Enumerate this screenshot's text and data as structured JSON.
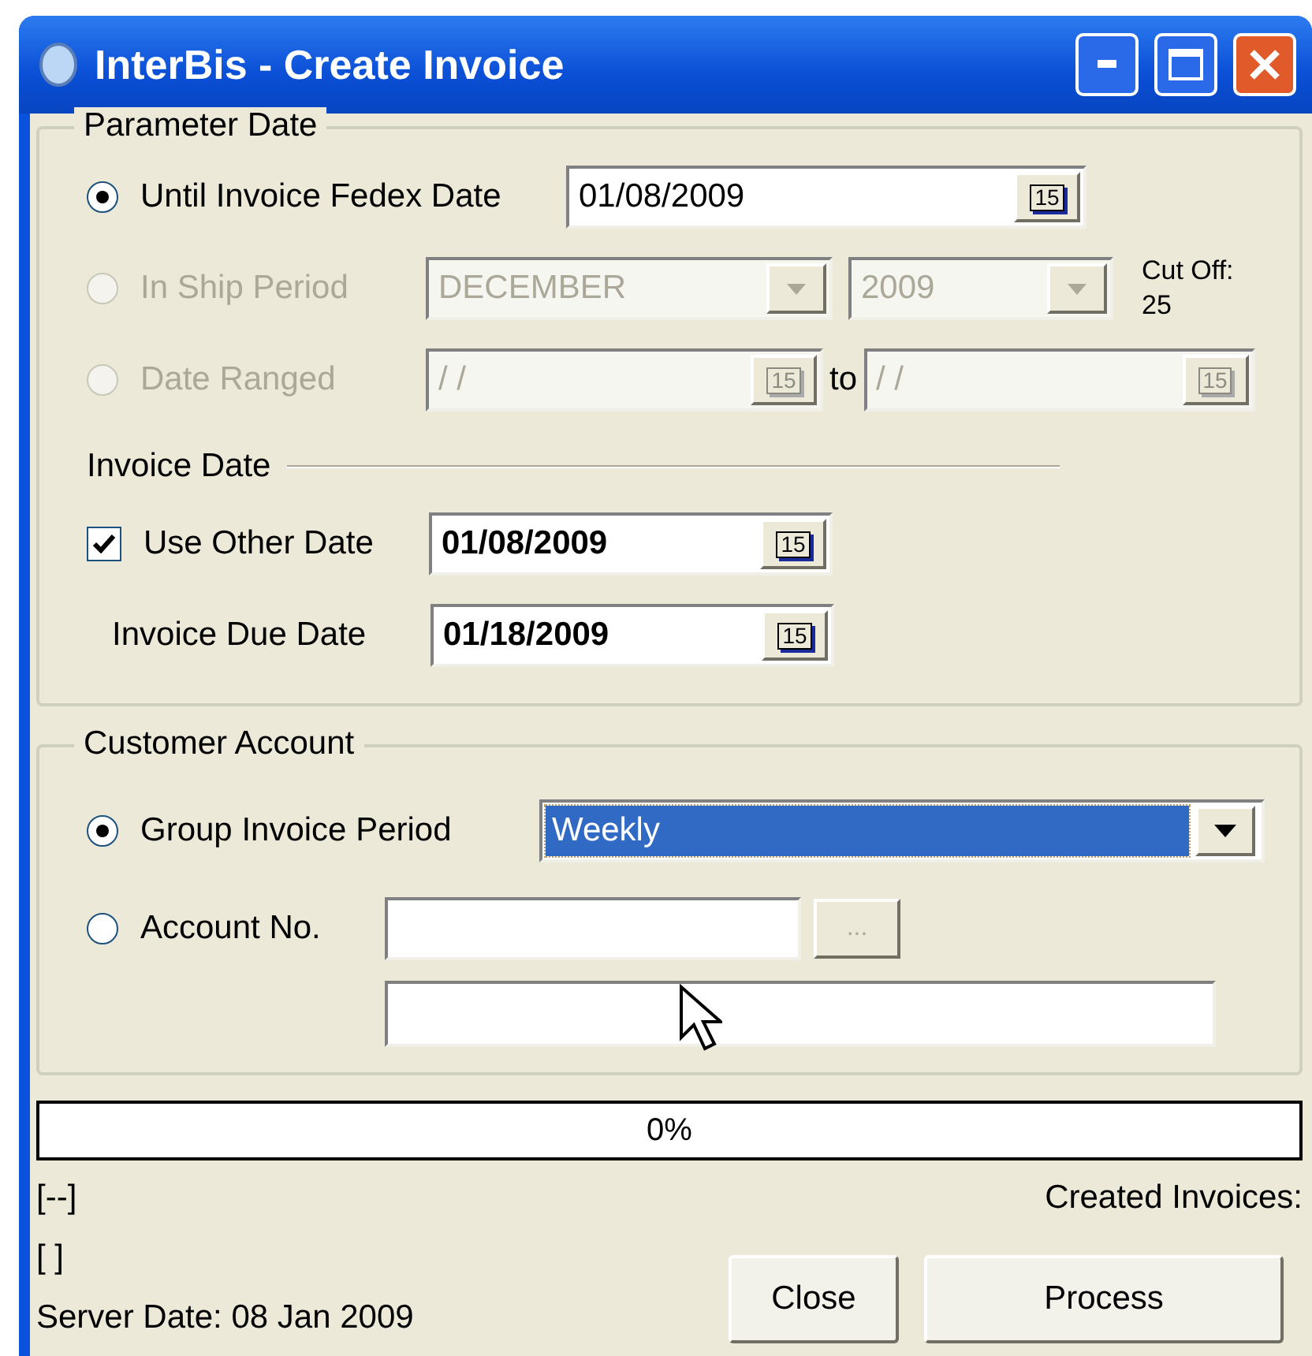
{
  "window": {
    "title": "InterBis - Create Invoice"
  },
  "parameter_date": {
    "legend": "Parameter Date",
    "options": [
      {
        "kind": "date",
        "label": "Until Invoice Fedex Date",
        "selected": true,
        "disabled": false,
        "value": "01/08/2009",
        "button": "15"
      },
      {
        "kind": "period",
        "label": "In Ship Period",
        "selected": false,
        "disabled": true,
        "month": "DECEMBER",
        "year": "2009",
        "cutoff_label": "Cut Off:",
        "cutoff_value": "25"
      },
      {
        "kind": "range",
        "label": "Date Ranged",
        "selected": false,
        "disabled": true,
        "from": "/ /",
        "from_button": "15",
        "to_label": "to",
        "to": "/ /",
        "to_button": "15"
      }
    ],
    "invoice_date": {
      "legend": "Invoice Date",
      "use_other": {
        "label": "Use Other Date",
        "checked": true,
        "value": "01/08/2009",
        "button": "15"
      },
      "due": {
        "label": "Invoice Due Date",
        "value": "01/18/2009",
        "button": "15"
      }
    }
  },
  "customer_account": {
    "legend": "Customer Account",
    "options": [
      {
        "kind": "select",
        "label": "Group Invoice Period",
        "selected": true,
        "value": "Weekly"
      },
      {
        "kind": "account",
        "label": "Account No.",
        "selected": false,
        "button": "..."
      }
    ]
  },
  "progress": {
    "level": 0,
    "text": "0%"
  },
  "status": {
    "line_1": "[--]",
    "line_2": "[ ]",
    "server_date": "Server Date: 08 Jan 2009",
    "created_invoices": "Created Invoices:"
  },
  "buttons": [
    "Close",
    "Process"
  ]
}
